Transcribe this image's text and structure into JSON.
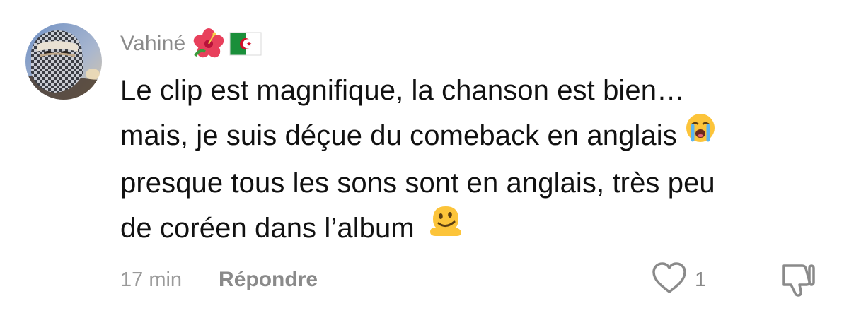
{
  "comment": {
    "username": "Vahiné",
    "username_emojis": [
      "hibiscus-emoji",
      "algeria-flag-emoji"
    ],
    "text_lines": [
      "Le clip est magnifique, la chanson est bien…",
      "mais, je suis déçue du comeback en anglais",
      "presque tous les sons sont en anglais, très peu",
      "de coréen dans l’album"
    ],
    "inline_emojis": [
      "loudly-crying-face-emoji",
      "melting-face-emoji"
    ],
    "timestamp": "17 min",
    "reply_label": "Répondre",
    "like_count": "1"
  },
  "colors": {
    "username": "#8a8a8a",
    "body_text": "#111111",
    "meta_text": "#9a9a9a",
    "icon_stroke": "#8a8a8a"
  }
}
